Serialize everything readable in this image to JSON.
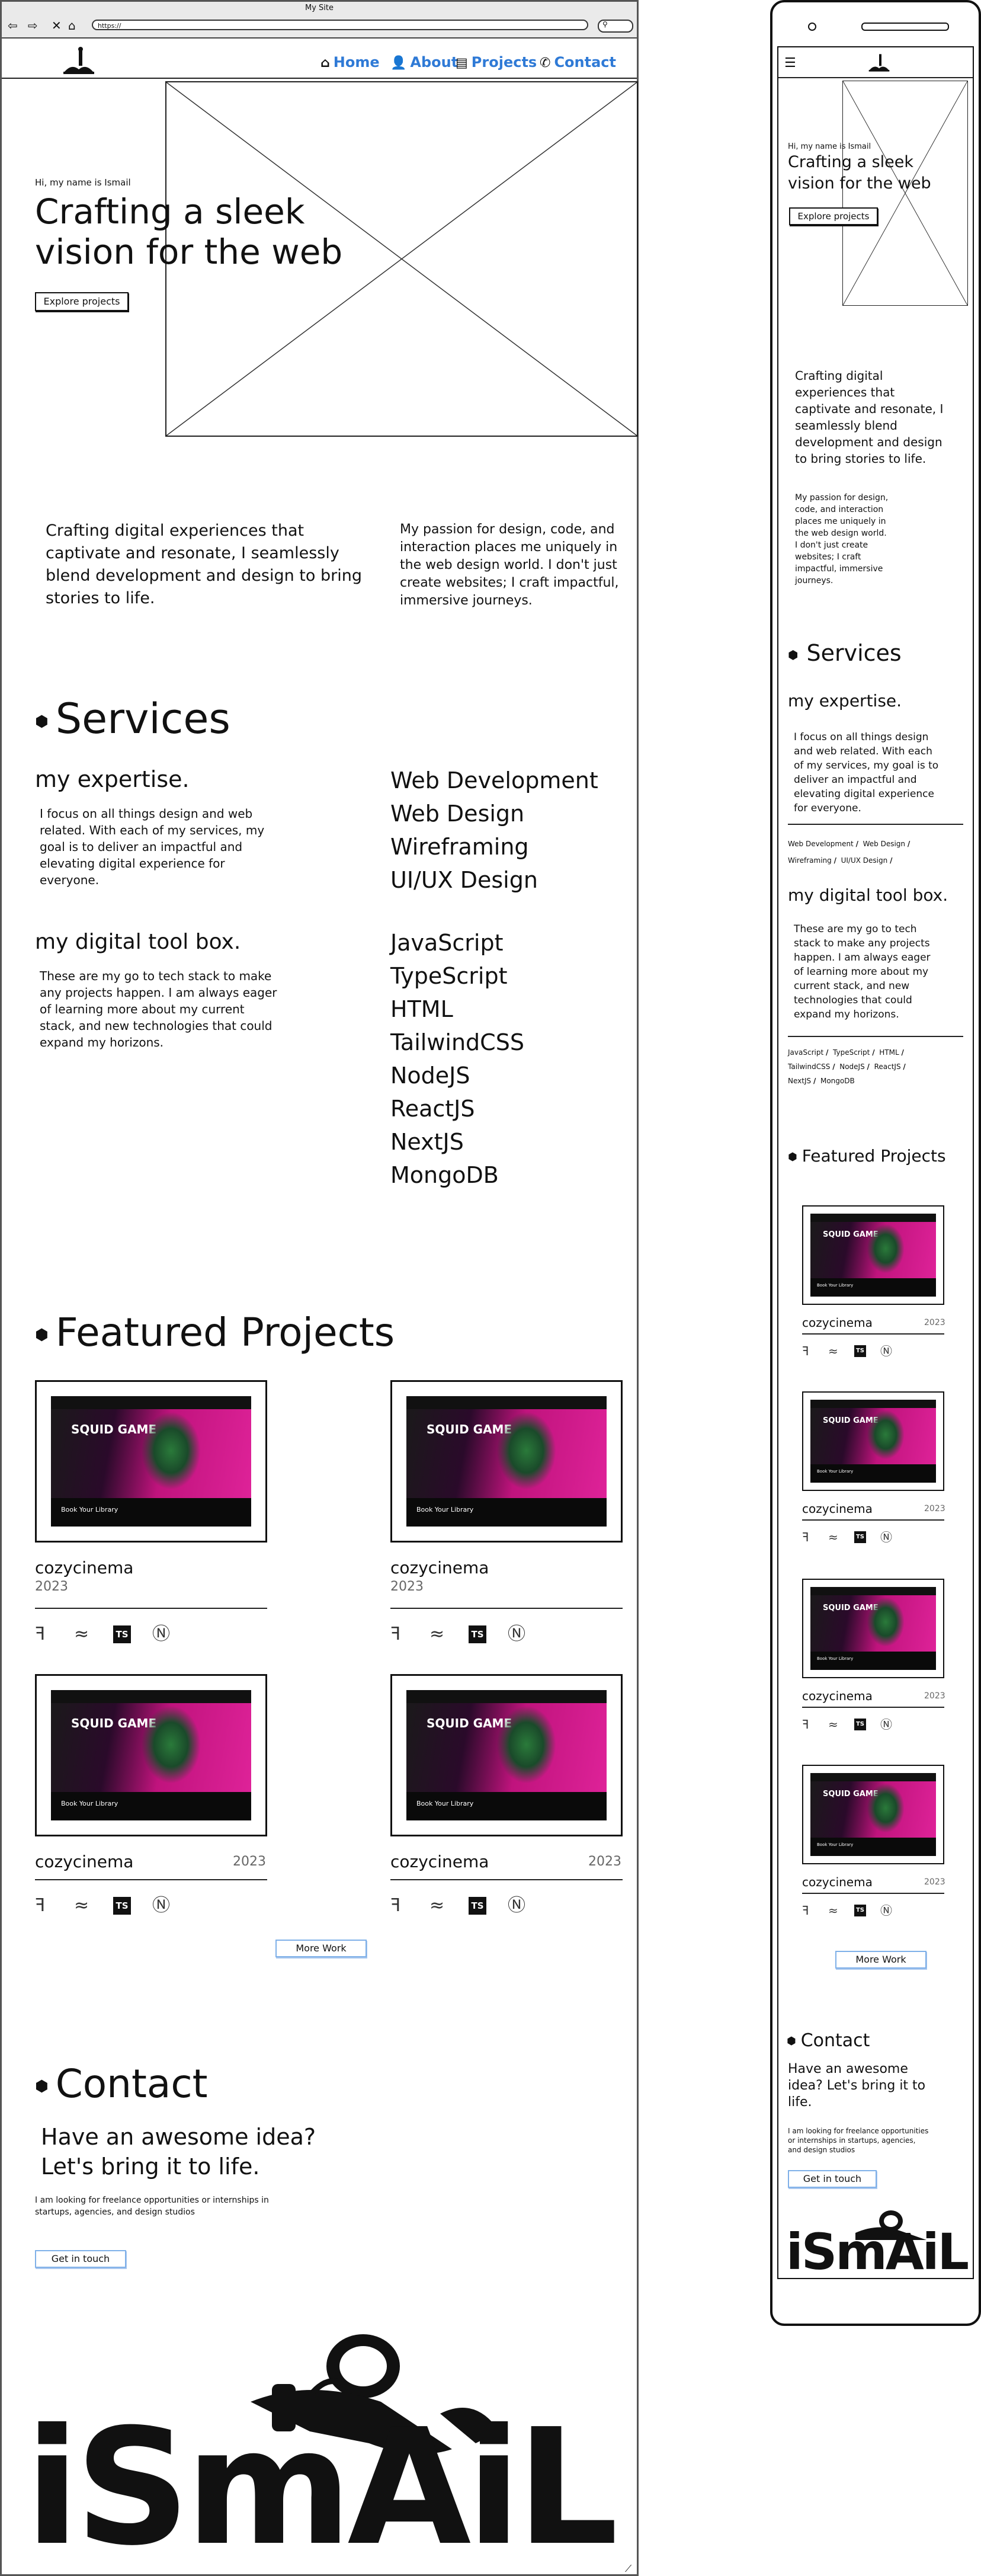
{
  "browser": {
    "title": "My Site",
    "url": "https://",
    "nav_icons": [
      "back-arrow-icon",
      "forward-arrow-icon",
      "close-icon",
      "home-icon"
    ]
  },
  "nav": {
    "items": [
      {
        "label": "Home",
        "icon": "home-icon"
      },
      {
        "label": "About",
        "icon": "user-icon"
      },
      {
        "label": "Projects",
        "icon": "book-icon"
      },
      {
        "label": "Contact",
        "icon": "phone-icon"
      }
    ]
  },
  "hero": {
    "greeting": "Hi, my name is Ismail",
    "headline_1": "Crafting a sleek",
    "headline_2": "vision for the web",
    "cta": "Explore projects"
  },
  "intro": {
    "left": "Crafting digital experiences that captivate and resonate, I seamlessly blend development and design to bring stories to life.",
    "right": "My passion for design, code, and interaction places me uniquely in the web design world. I don't just create websites; I craft impactful, immersive journeys."
  },
  "services": {
    "heading": "Services",
    "expertise_title": "my expertise.",
    "expertise_text": "I focus on all things design and web related. With each of my services, my goal is to deliver an impactful and elevating digital experience for everyone.",
    "expertise_items": [
      "Web Development",
      "Web Design",
      "Wireframing",
      "UI/UX Design"
    ],
    "toolbox_title": "my digital tool box.",
    "toolbox_text": "These are my go to tech stack to make any projects happen. I am always eager of learning more about my current stack, and new technologies that could expand my horizons.",
    "toolbox_items": [
      "JavaScript",
      "TypeScript",
      "HTML",
      "TailwindCSS",
      "NodeJS",
      "ReactJS",
      "NextJS",
      "MongoDB"
    ]
  },
  "projects": {
    "heading": "Featured Projects",
    "items": [
      {
        "name": "cozycinema",
        "year": "2023"
      },
      {
        "name": "cozycinema",
        "year": "2023"
      },
      {
        "name": "cozycinema",
        "year": "2023"
      },
      {
        "name": "cozycinema",
        "year": "2023"
      }
    ],
    "tech_icons": [
      "figma-icon",
      "tailwind-icon",
      "typescript-icon",
      "nextjs-icon"
    ],
    "ts_label": "TS",
    "shot_title": "SQUID GAME",
    "shot_footer": "Book Your Library",
    "more_work": "More Work"
  },
  "contact": {
    "heading": "Contact",
    "tagline_1": "Have an awesome idea?",
    "tagline_2": "Let's bring it to life.",
    "text_1": "I am looking for freelance opportunities or internships in",
    "text_2": "startups, agencies, and design studios",
    "cta": "Get in touch"
  },
  "footer": {
    "logo_text": "iSmAiL"
  },
  "mobile": {
    "menu_icon": "hamburger-icon",
    "hero_greeting": "Hi, my name is Ismail",
    "hero_headline_1": "Crafting a sleek",
    "hero_headline_2": "vision for the web",
    "hero_cta": "Explore projects",
    "intro_1": [
      "Crafting digital",
      "experiences that",
      "captivate and resonate, I",
      "seamlessly blend",
      "development and design",
      "to bring stories to life."
    ],
    "intro_2": [
      "My passion for design,",
      "code, and interaction",
      "places me uniquely in",
      "the web design world.",
      "I don't just create",
      "websites; I craft",
      "impactful, immersive",
      "journeys."
    ],
    "services_heading": "Services",
    "expertise_title": "my expertise.",
    "expertise_text": [
      "I focus on all things design",
      "and web related. With each",
      "of my services, my goal is to",
      "deliver an impactful and",
      "elevating digital experience",
      "for everyone."
    ],
    "toolbox_title": "my digital tool box.",
    "toolbox_text": [
      "These are my go to tech",
      "stack to make any projects",
      "happen. I am always eager",
      "of learning more about my",
      "current stack, and new",
      "technologies that could",
      "expand my horizons."
    ],
    "projects_heading": "Featured Projects",
    "contact_heading": "Contact",
    "contact_tagline": [
      "Have an awesome",
      "idea? Let's bring it to",
      "life."
    ],
    "contact_text": [
      "I am looking for freelance opportunities",
      "or internships in startups, agencies,",
      "and design studios"
    ],
    "contact_cta": "Get in touch",
    "more_work": "More Work"
  }
}
